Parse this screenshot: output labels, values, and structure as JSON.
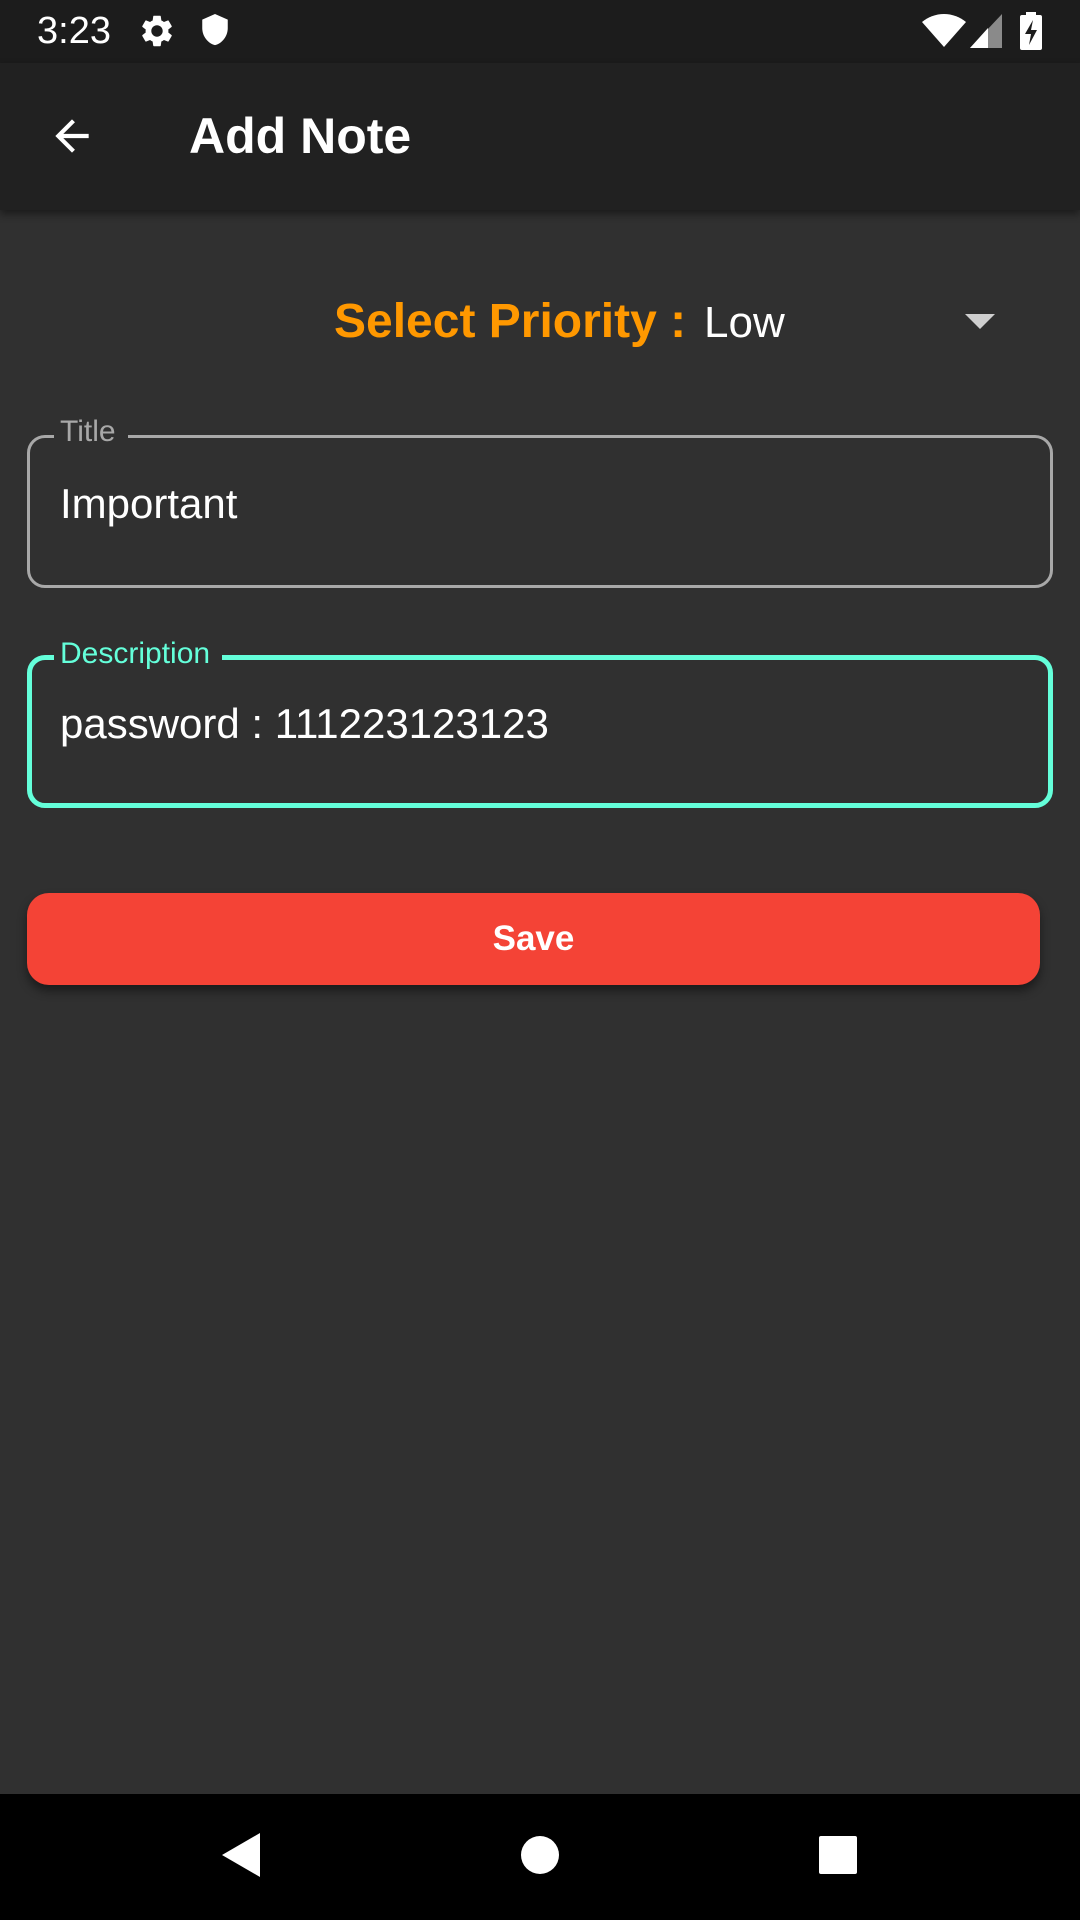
{
  "status_bar": {
    "time": "3:23",
    "icons": [
      "gear-icon",
      "shield-icon",
      "wifi-icon",
      "signal-icon",
      "battery-charging-icon"
    ]
  },
  "app_bar": {
    "back_icon": "arrow-back-icon",
    "title": "Add Note"
  },
  "priority": {
    "label": "Select Priority :",
    "selected": "Low",
    "dropdown_icon": "arrow-drop-down-icon"
  },
  "form": {
    "title_field": {
      "label": "Title",
      "value": "Important"
    },
    "description_field": {
      "label": "Description",
      "value": "password : 111223123123"
    },
    "save_label": "Save"
  },
  "nav_bar": {
    "icons": [
      "nav-back-icon",
      "nav-home-icon",
      "nav-recents-icon"
    ]
  },
  "colors": {
    "background": "#303030",
    "app_bar": "#212121",
    "status_bar": "#1c1c1c",
    "priority_label": "#ff9800",
    "focused_outline": "#64ffda",
    "idle_outline": "#a8a8a8",
    "save_button": "#f44336",
    "text": "#ffffff"
  }
}
